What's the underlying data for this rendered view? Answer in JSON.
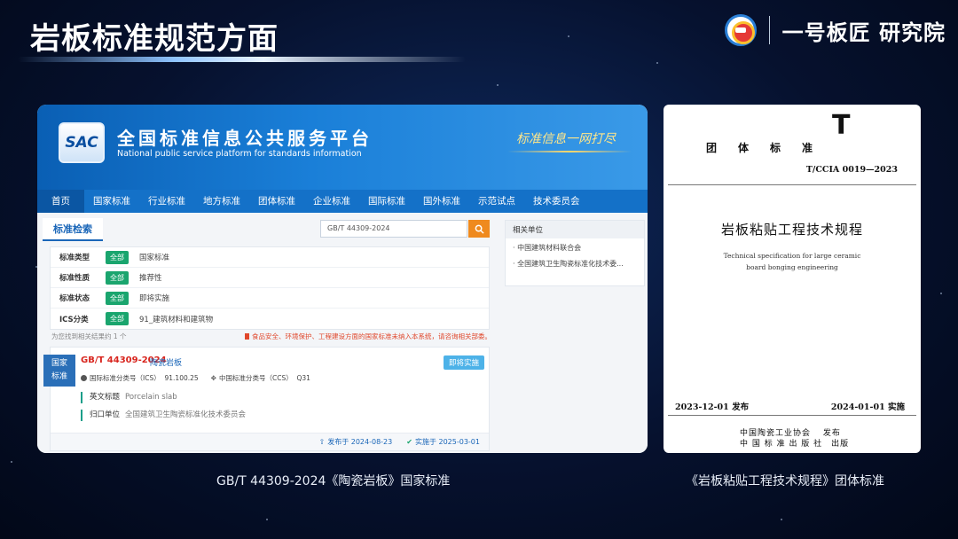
{
  "slide": {
    "title": "岩板标准规范方面",
    "brand": "一号板匠 研究院"
  },
  "sac": {
    "logo_text": "SAC",
    "title": "全国标准信息公共服务平台",
    "subtitle": "National public service platform  for standards information",
    "slogan": "标准信息一网打尽",
    "nav": [
      "首页",
      "国家标准",
      "行业标准",
      "地方标准",
      "团体标准",
      "企业标准",
      "国际标准",
      "国外标准",
      "示范试点",
      "技术委员会"
    ],
    "search_tab": "标准检索",
    "search_value": "GB/T 44309-2024",
    "filters": [
      {
        "label": "标准类型",
        "all": "全部",
        "value": "国家标准"
      },
      {
        "label": "标准性质",
        "all": "全部",
        "value": "推荐性"
      },
      {
        "label": "标准状态",
        "all": "全部",
        "value": "即将实施"
      },
      {
        "label": "ICS分类",
        "all": "全部",
        "value": "91_建筑材料和建筑物"
      }
    ],
    "result_count": "为您找到相关结果约 1 个",
    "notice": "食品安全、环境保护、工程建设方面的国家标准未纳入本系统，请咨询相关部委。",
    "result": {
      "badge_line1": "国家",
      "badge_line2": "标准",
      "code": "GB/T 44309-2024",
      "name": "陶瓷岩板",
      "status": "即将实施",
      "ics_label": "国际标准分类号（ICS）",
      "ics_value": "91.100.25",
      "ccs_label": "中国标准分类号（CCS）",
      "ccs_value": "Q31",
      "en_title_label": "英文标题",
      "en_title_value": "Porcelain slab",
      "unit_label": "归口单位",
      "unit_value": "全国建筑卫生陶瓷标准化技术委员会",
      "published": "发布于 2024-08-23",
      "implemented": "实施于 2025-03-01"
    },
    "related": {
      "title": "相关单位",
      "items": [
        "中国建筑材料联合会",
        "全国建筑卫生陶瓷标准化技术委..."
      ]
    }
  },
  "cover": {
    "letter": "T",
    "category": "团体标准",
    "code": "T/CCIA 0019—2023",
    "name": "岩板粘贴工程技术规程",
    "en_line1": "Technical specification for large ceramic",
    "en_line2": "board bonging engineering",
    "published": "2023-12-01 发布",
    "implemented": "2024-01-01 实施",
    "issuer1": "中国陶瓷工业协会　 发布",
    "issuer2": "中 国 标 准 出 版 社　出版"
  },
  "captions": {
    "left": "GB/T 44309-2024《陶瓷岩板》国家标准",
    "right": "《岩板粘贴工程技术规程》团体标准"
  }
}
